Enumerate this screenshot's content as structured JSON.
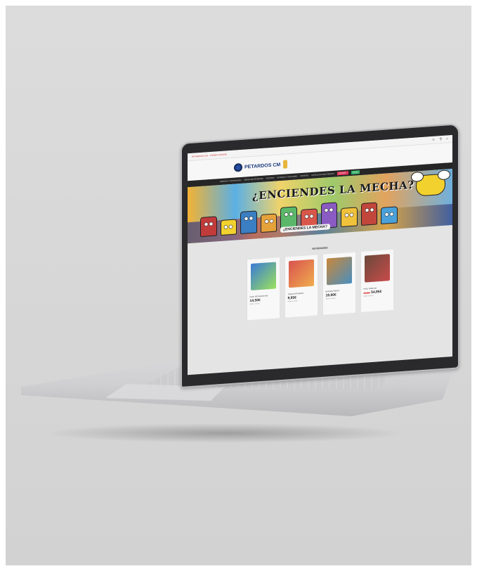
{
  "site": {
    "topbar": {
      "contact": "PETARDOS CM · TIENDA ONLINE",
      "icons": [
        "user-icon",
        "cart-icon",
        "search-icon"
      ]
    },
    "logo_text": "PETARDOS CM",
    "nav": {
      "items": [
        "Ofertas y novedades",
        "Tienda de petardos",
        "Fuentes",
        "Baterías y volcanes",
        "Cohetes",
        "Artículos para fiestas"
      ],
      "pills": [
        "Outlet",
        "Club"
      ]
    },
    "banner": {
      "title": "¿ENCIENDES LA MECHA?",
      "subtitle": "¿ENCIENDES LA MECHA?"
    },
    "featured": {
      "title": "NOVEDADES",
      "products": [
        {
          "name": "PACK PETARDOS MIX",
          "price": "14,50€",
          "old_price": "",
          "note": "Añadir al carrito",
          "colors": [
            "#3a7bd5",
            "#9be15d"
          ]
        },
        {
          "name": "TRACA PETARDOS",
          "price": "9,95€",
          "old_price": "",
          "note": "Añadir al carrito",
          "colors": [
            "#d9534f",
            "#f0ad4e"
          ]
        },
        {
          "name": "BATERÍA FIESTA",
          "price": "19,90€",
          "old_price": "",
          "note": "Añadir al carrito",
          "colors": [
            "#c8873a",
            "#4a8fbf"
          ]
        },
        {
          "name": "PACK FAMILIAR",
          "price": "54,95€",
          "old_price": "69,95€",
          "note": "Añadir al carrito",
          "colors": [
            "#6b4a3a",
            "#c94b4b"
          ]
        }
      ]
    }
  },
  "colors": {
    "nav_bg": "#262626",
    "pill_red": "#e03a5c",
    "pill_green": "#3ab56a",
    "logo_blue": "#1b3a7a"
  }
}
